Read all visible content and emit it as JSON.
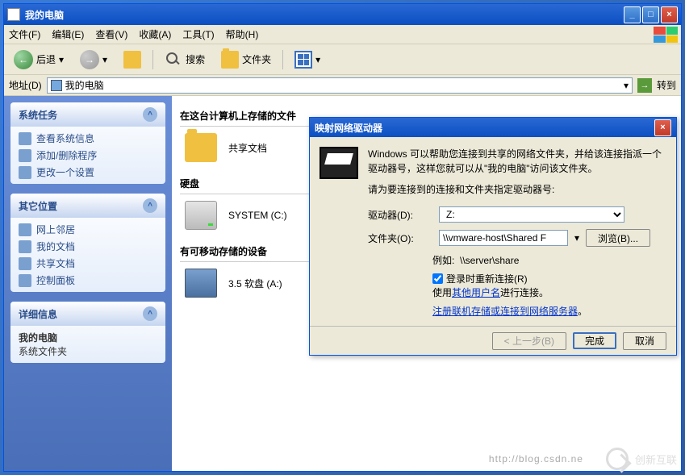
{
  "window": {
    "title": "我的电脑",
    "menu": [
      "文件(F)",
      "编辑(E)",
      "查看(V)",
      "收藏(A)",
      "工具(T)",
      "帮助(H)"
    ],
    "toolbar": {
      "back": "后退",
      "search": "搜索",
      "folders": "文件夹"
    },
    "address": {
      "label": "地址(D)",
      "value": "我的电脑",
      "go": "转到"
    }
  },
  "sidebar": {
    "tasks": {
      "title": "系统任务",
      "items": [
        {
          "label": "查看系统信息",
          "icon": "info-icon"
        },
        {
          "label": "添加/删除程序",
          "icon": "add-remove-icon"
        },
        {
          "label": "更改一个设置",
          "icon": "settings-icon"
        }
      ]
    },
    "places": {
      "title": "其它位置",
      "items": [
        {
          "label": "网上邻居",
          "icon": "network-icon"
        },
        {
          "label": "我的文档",
          "icon": "documents-icon"
        },
        {
          "label": "共享文档",
          "icon": "shared-docs-icon"
        },
        {
          "label": "控制面板",
          "icon": "control-panel-icon"
        }
      ]
    },
    "details": {
      "title": "详细信息",
      "name": "我的电脑",
      "type": "系统文件夹"
    }
  },
  "main": {
    "section1": {
      "title": "在这台计算机上存储的文件",
      "item": "共享文档"
    },
    "section2": {
      "title": "硬盘",
      "item": "SYSTEM (C:)"
    },
    "section3": {
      "title": "有可移动存储的设备",
      "item": "3.5 软盘 (A:)"
    }
  },
  "dialog": {
    "title": "映射网络驱动器",
    "desc": "Windows 可以帮助您连接到共享的网络文件夹，并给该连接指派一个驱动器号，这样您就可以从\"我的电脑\"访问该文件夹。",
    "prompt": "请为要连接到的连接和文件夹指定驱动器号:",
    "drive_label": "驱动器(D):",
    "drive_value": "Z:",
    "folder_label": "文件夹(O):",
    "folder_value": "\\\\vmware-host\\Shared F",
    "browse": "浏览(B)...",
    "example_label": "例如:",
    "example_value": "\\\\server\\share",
    "reconnect": "登录时重新连接(R)",
    "other_user_pre": "使用",
    "other_user_link": "其他用户名",
    "other_user_post": "进行连接。",
    "storage_link": "注册联机存储或连接到网络服务器",
    "back": "< 上一步(B)",
    "finish": "完成",
    "cancel": "取消"
  },
  "watermark": {
    "blog": "http://blog.csdn.ne",
    "brand": "创新互联"
  }
}
